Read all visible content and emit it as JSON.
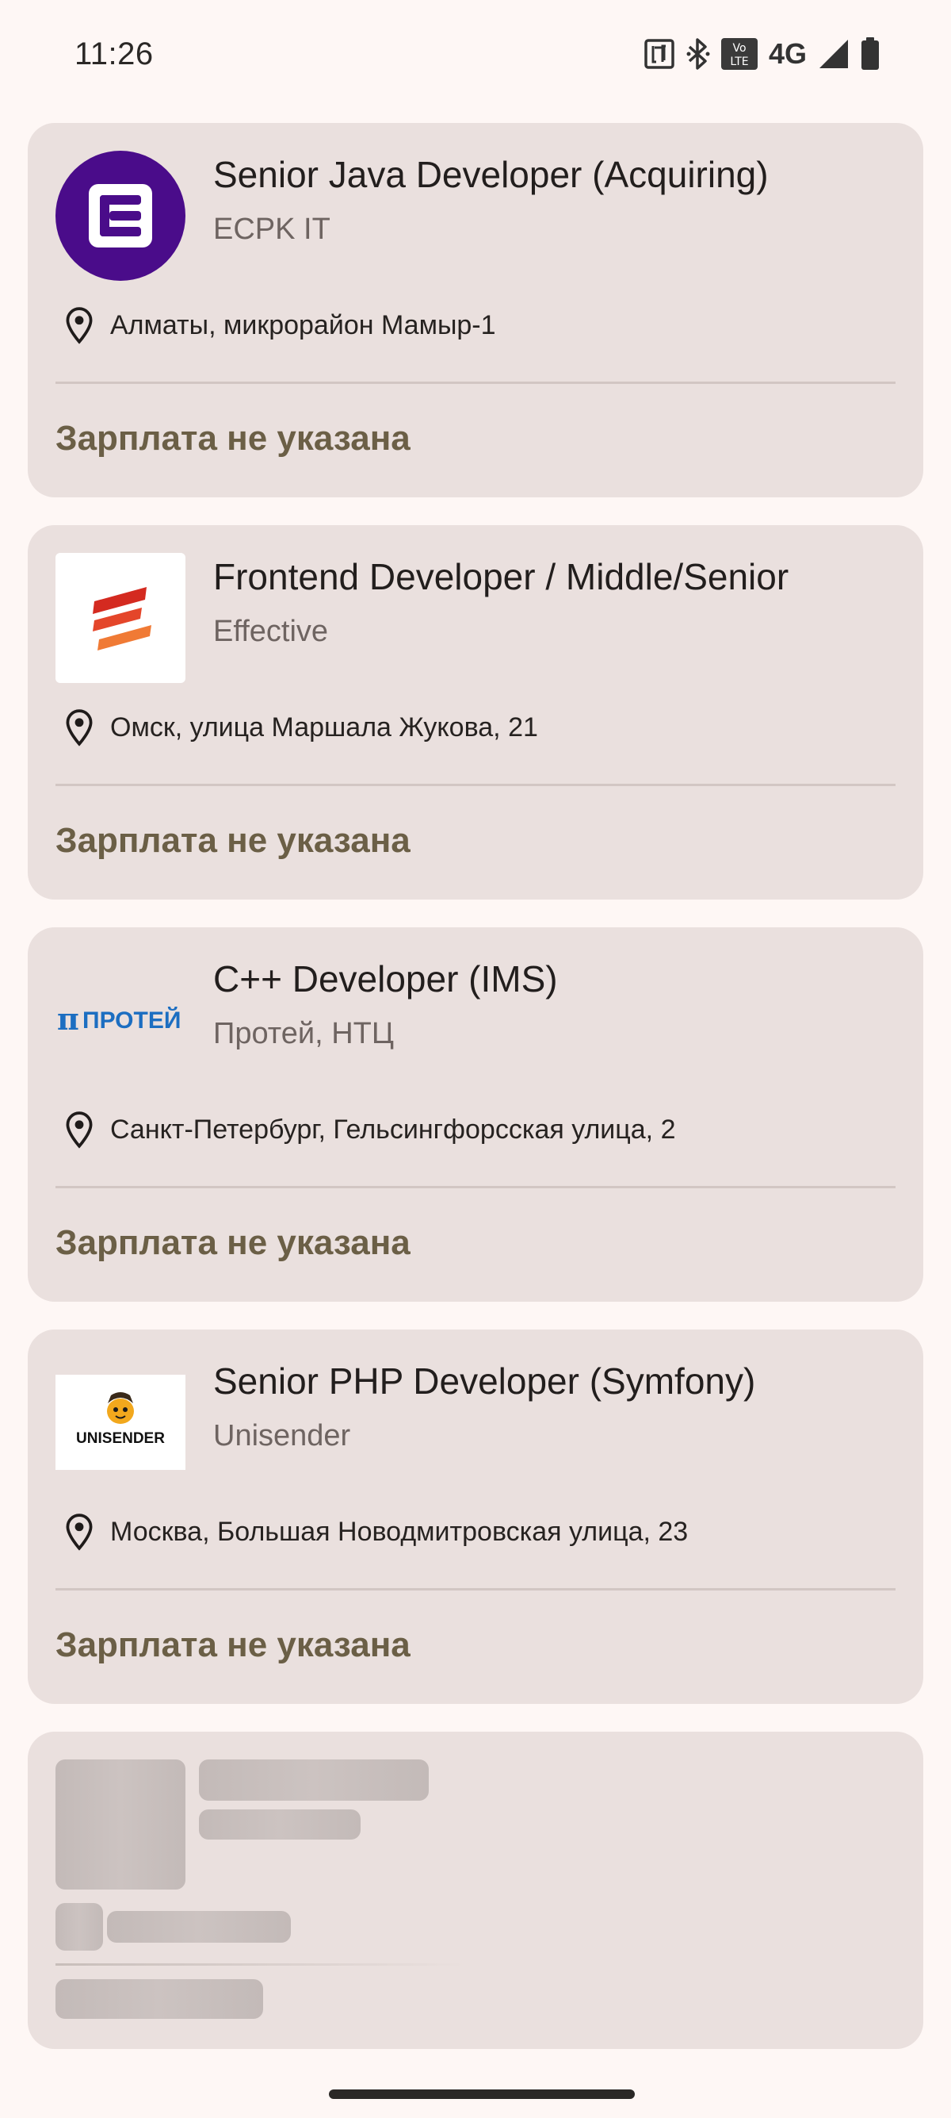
{
  "status_bar": {
    "time": "11:26",
    "network": "4G",
    "icons": [
      "nfc-icon",
      "bluetooth-icon",
      "volte-icon",
      "signal-icon",
      "battery-icon"
    ]
  },
  "jobs": [
    {
      "title": "Senior Java Developer (Acquiring)",
      "company": "ECPK IT",
      "location": "Алматы, микрорайон Мамыр-1",
      "salary": "Зарплата не указана",
      "logo": "ecpk-logo"
    },
    {
      "title": "Frontend Developer / Middle/Senior",
      "company": "Effective",
      "location": "Омск, улица Маршала Жукова, 21",
      "salary": "Зарплата не указана",
      "logo": "effective-logo"
    },
    {
      "title": "C++ Developer (IMS)",
      "company": "Протей, НТЦ",
      "location": "Санкт-Петербург, Гельсингфорсская улица, 2",
      "salary": "Зарплата не указана",
      "logo": "protei-logo",
      "logo_text": "ПРОТЕЙ"
    },
    {
      "title": "Senior PHP Developer (Symfony)",
      "company": "Unisender",
      "location": "Москва, Большая Новодмитровская улица, 23",
      "salary": "Зарплата не указана",
      "logo": "unisender-logo",
      "logo_text": "UNISENDER"
    }
  ],
  "colors": {
    "background": "#FEF7F5",
    "card": "#EAE0DE",
    "salary": "#6B5F46",
    "ecpk_brand": "#4A0C8A",
    "protei_brand": "#1C6EC1"
  }
}
